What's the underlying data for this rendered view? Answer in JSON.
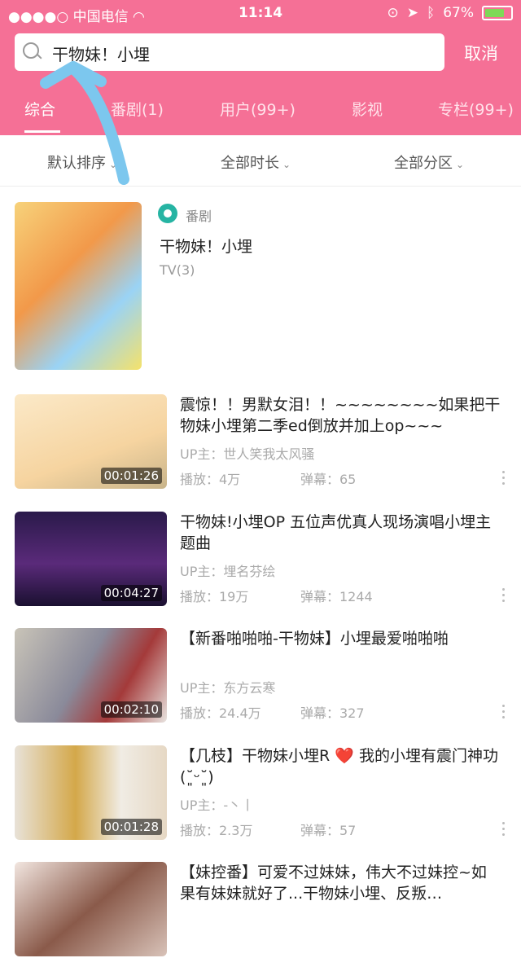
{
  "status": {
    "carrier": "中国电信",
    "time": "11:14",
    "battery": "67%",
    "battery_level": 0.67
  },
  "search": {
    "query": "干物妹！小埋",
    "cancel": "取消"
  },
  "tabs": [
    "综合",
    "番剧(1)",
    "用户(99+)",
    "影视",
    "专栏(99+)"
  ],
  "filters": [
    "默认排序",
    "全部时长",
    "全部分区"
  ],
  "bangumi": {
    "badge": "番剧",
    "title": "干物妹！小埋",
    "sub": "TV(3)"
  },
  "videos": [
    {
      "title": "震惊！！男默女泪！！~~~~~~~~如果把干物妹小埋第二季ed倒放并加上op~~~",
      "up": "UP主：世人笑我太风骚",
      "play": "播放：4万",
      "danmaku": "弹幕：65",
      "duration": "00:01:26"
    },
    {
      "title": "干物妹!小埋OP 五位声优真人现场演唱小埋主题曲",
      "up": "UP主：埋名芬绘",
      "play": "播放：19万",
      "danmaku": "弹幕：1244",
      "duration": "00:04:27"
    },
    {
      "title": "【新番啪啪啪-干物妹】小埋最爱啪啪啪",
      "up": "UP主：东方云寒",
      "play": "播放：24.4万",
      "danmaku": "弹幕：327",
      "duration": "00:02:10"
    },
    {
      "title": "【几枝】干物妹小埋R ❤️ 我的小埋有震门神功 (˘͈ᵕ˘͈)",
      "up": "UP主：-丶丨",
      "play": "播放：2.3万",
      "danmaku": "弹幕：57",
      "duration": "00:01:28"
    },
    {
      "title": "【妹控番】可爱不过妹妹，伟大不过妹控~如果有妹妹就好了...干物妹小埋、反叛…",
      "up": "",
      "play": "",
      "danmaku": "",
      "duration": ""
    }
  ],
  "colors": {
    "accent": "#f57096",
    "badge": "#26b4a3",
    "arrow": "#7cc7ee"
  }
}
